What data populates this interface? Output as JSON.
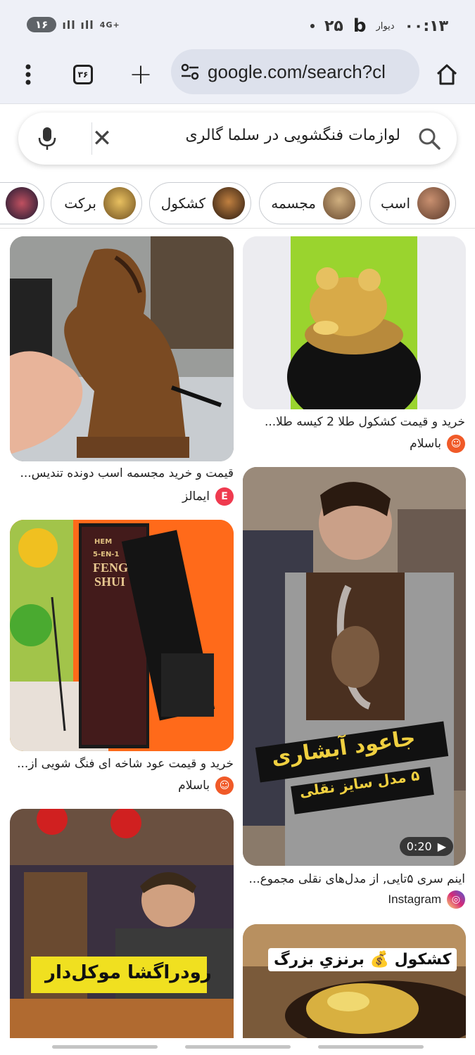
{
  "status_bar": {
    "time": "۰۰:۱۳",
    "app_label": "دیوار",
    "app_letter": "b",
    "date_num": "۲۵",
    "battery": "۱۶",
    "signal": "4G+"
  },
  "browser": {
    "url": "google.com/search?cl",
    "tab_count": "۳۶"
  },
  "search": {
    "query": "لوازمات فنگشویی در سلما گالری"
  },
  "chips": [
    {
      "label": "اسب",
      "thumb_color": "#a0705a"
    },
    {
      "label": "مجسمه",
      "thumb_color": "#8a6a4a"
    },
    {
      "label": "کشکول",
      "thumb_color": "#5a3a2a"
    },
    {
      "label": "برکت",
      "thumb_color": "#b8923a"
    },
    {
      "label": "",
      "thumb_color": "#3a3050"
    }
  ],
  "results": [
    {
      "title": "قیمت و خرید مجسمه اسب دونده تندیس...",
      "source": "ایمالز",
      "source_color": "#ef3a4f",
      "source_glyph": "E"
    },
    {
      "title": "خرید و قیمت کشکول طلا 2 کیسه طلا...",
      "source": "باسلام",
      "source_color": "#f05a28",
      "source_glyph": "☺"
    },
    {
      "title": "خرید و قیمت عود شاخه ای فنگ شویی از...",
      "source": "باسلام",
      "source_color": "#f05a28",
      "source_glyph": "☺",
      "overlay_text": [
        "HEM",
        "5-EN-1",
        "FENG",
        "SHUI"
      ]
    },
    {
      "title": "اینم سری ۵تایی, از مدل‌های نقلی مجموع...",
      "source": "Instagram",
      "source_color": "#d62976",
      "source_glyph": "◎",
      "overlay_line1": "جاعود آبشاری",
      "overlay_line2": "۵ مدل سایز نقلی",
      "video_duration": "0:20"
    },
    {
      "overlay_text": "رودراگشا موکل‌دار"
    },
    {
      "overlay_text": "کشکول 💰 برنزیِ بزرگ"
    }
  ]
}
